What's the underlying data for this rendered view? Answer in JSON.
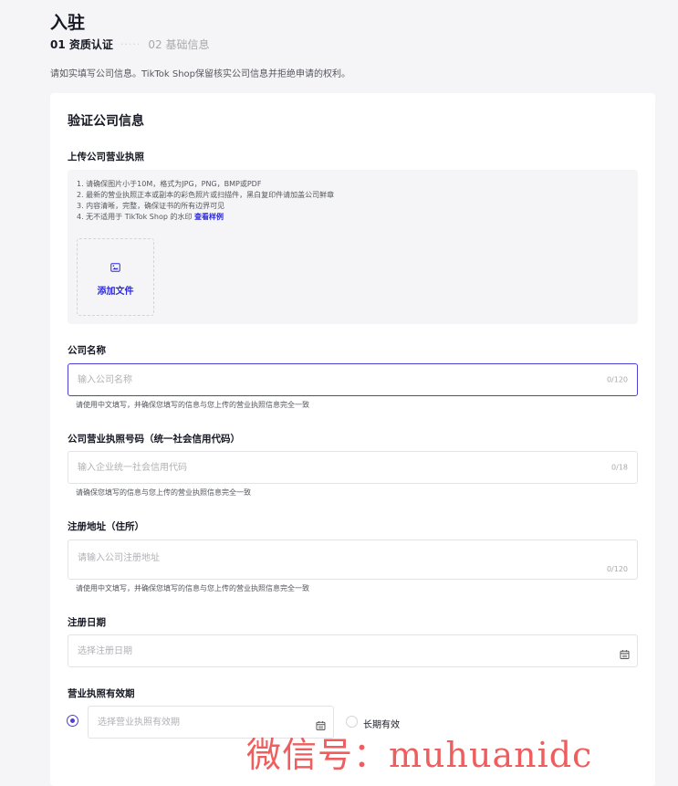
{
  "header": {
    "title": "入驻",
    "step_active": "01 资质认证",
    "step_dots": "·····",
    "step_next": "02 基础信息",
    "intro": "请如实填写公司信息。TikTok Shop保留核实公司信息并拒绝申请的权利。"
  },
  "card": {
    "title": "验证公司信息",
    "license_upload": {
      "label": "上传公司营业执照",
      "notes": [
        "1. 请确保图片小于10M，格式为JPG，PNG，BMP或PDF",
        "2. 最新的营业执照正本或副本的彩色照片或扫描件，黑白复印件请加盖公司鲜章",
        "3. 内容清晰，完整，确保证书的所有边界可见",
        "4. 无不适用于 TikTok Shop 的水印"
      ],
      "sample_link": "查看样例",
      "add_file": "添加文件"
    },
    "company_name": {
      "label": "公司名称",
      "placeholder": "输入公司名称",
      "counter": "0/120",
      "helper": "请使用中文填写，并确保您填写的信息与您上传的营业执照信息完全一致"
    },
    "license_number": {
      "label": "公司营业执照号码（统一社会信用代码）",
      "placeholder": "输入企业统一社会信用代码",
      "counter": "0/18",
      "helper": "请确保您填写的信息与您上传的营业执照信息完全一致"
    },
    "address": {
      "label": "注册地址（住所）",
      "placeholder": "请输入公司注册地址",
      "counter": "0/120",
      "helper": "请使用中文填写，并确保您填写的信息与您上传的营业执照信息完全一致"
    },
    "reg_date": {
      "label": "注册日期",
      "placeholder": "选择注册日期"
    },
    "validity": {
      "label": "营业执照有效期",
      "placeholder": "选择营业执照有效期",
      "long_term": "长期有效"
    }
  },
  "watermark": "微信号：muhuanidc",
  "colors": {
    "accent": "#4b3fd8",
    "link": "#2d2ad6",
    "background": "#f5f5f7",
    "watermark": "#e82828"
  },
  "icons": {
    "upload": "image-icon",
    "date": "calendar-icon",
    "validity_date": "calendar-icon"
  }
}
